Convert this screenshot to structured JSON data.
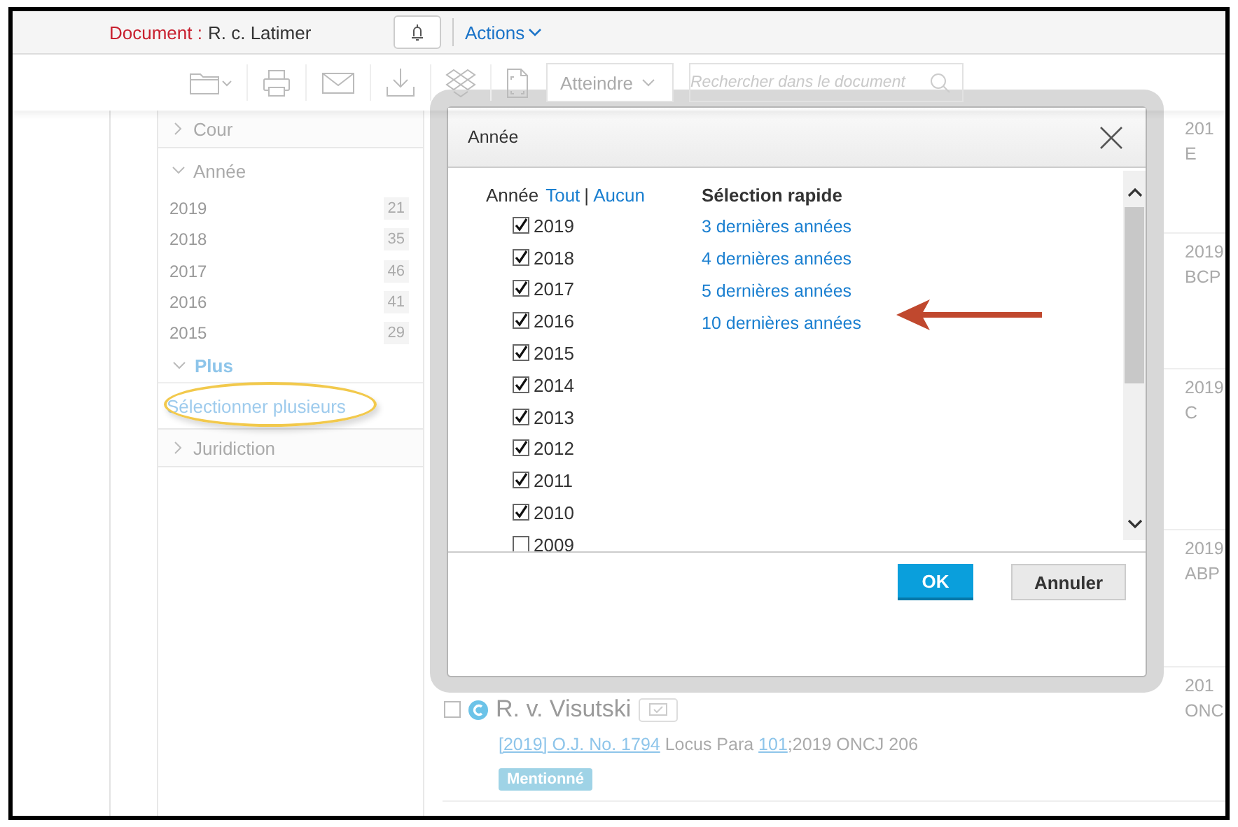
{
  "header": {
    "label": "Document :",
    "title": "R. c. Latimer",
    "actions": "Actions"
  },
  "toolbar": {
    "goto": "Atteindre",
    "search": {
      "placeholder": "Rechercher dans le document"
    }
  },
  "sidebar": {
    "sections": [
      {
        "title": "Cour",
        "expanded": false
      },
      {
        "title": "Année",
        "expanded": true,
        "items": [
          {
            "label": "2019",
            "count": "21"
          },
          {
            "label": "2018",
            "count": "35"
          },
          {
            "label": "2017",
            "count": "46"
          },
          {
            "label": "2016",
            "count": "41"
          },
          {
            "label": "2015",
            "count": "29"
          }
        ],
        "more": "Plus",
        "select_multiple": "Sélectionner plusieurs"
      },
      {
        "title": "Juridiction",
        "expanded": false
      }
    ]
  },
  "results": [
    {
      "column_3": [
        "201",
        "E"
      ]
    },
    {
      "column_3": [
        "2019",
        "BCP"
      ]
    },
    {
      "column_3": [
        "2019",
        "C"
      ]
    },
    {
      "column_3": [
        "2019",
        "ABP"
      ]
    },
    {
      "title": "R. v. Visutski",
      "checked": false,
      "citation": [
        {
          "text": "[2019] O.J. No. 1794",
          "link": true
        },
        {
          "text": " Locus Para ",
          "link": false
        },
        {
          "text": "101",
          "link": true
        },
        {
          "text": ";2019 ONCJ 206",
          "link": false
        }
      ],
      "tag": "Mentionné",
      "column_3": [
        "201",
        "ONC"
      ]
    }
  ],
  "dialog": {
    "title": "Année",
    "year_label": "Année",
    "all": "Tout",
    "separator": "|",
    "none": "Aucun",
    "quick_title": "Sélection rapide",
    "years": [
      {
        "label": "2019",
        "checked": true
      },
      {
        "label": "2018",
        "checked": true
      },
      {
        "label": "2017",
        "checked": true
      },
      {
        "label": "2016",
        "checked": true
      },
      {
        "label": "2015",
        "checked": true
      },
      {
        "label": "2014",
        "checked": true
      },
      {
        "label": "2013",
        "checked": true
      },
      {
        "label": "2012",
        "checked": true
      },
      {
        "label": "2011",
        "checked": true
      },
      {
        "label": "2010",
        "checked": true
      },
      {
        "label": "2009",
        "checked": false
      }
    ],
    "quick": [
      "3 dernières années",
      "4 dernières années",
      "5 dernières années",
      "10 dernières années"
    ],
    "ok": "OK",
    "cancel": "Annuler"
  }
}
